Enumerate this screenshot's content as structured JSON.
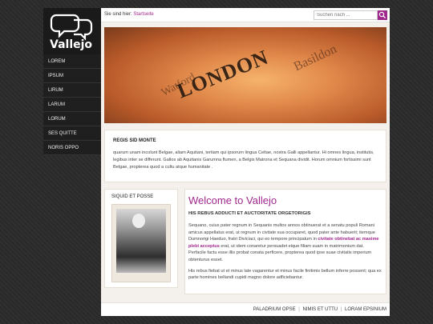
{
  "sidebar": {
    "logo_text": "Vallejo",
    "items": [
      {
        "label": "LOREM"
      },
      {
        "label": "IPSUM"
      },
      {
        "label": "LIRUM"
      },
      {
        "label": "LARUM"
      },
      {
        "label": "LORUM"
      },
      {
        "label": "SES QUITTE"
      },
      {
        "label": "NORIS OPPO"
      }
    ]
  },
  "topbar": {
    "breadcrumb_prefix": "Sie sind hier:",
    "breadcrumb_link": "Startseite",
    "search_placeholder": "Suchen nach ...",
    "search_icon": "search-icon"
  },
  "hero": {
    "label": "LONDON",
    "sub1": "Basildon",
    "sub2": "Watford"
  },
  "intro": {
    "title": "REGIS SID MONTE",
    "text": "quarum unam incolunt Belgae, aliam Aquitani, tertiam qui ipsorum lingua Celtae, nostra Galli appellantur. Hi omnes lingua, institutis, legibus inter se differunt. Gallos ab Aquitanis Garumna flumen, a Belgis Matrona et Sequana dividit. Horum omnium fortissimi sunt Belgae, propterea quod a cultu atque humanitate ."
  },
  "left_panel": {
    "title": "SIQUID ET POSSE"
  },
  "content": {
    "heading": "Welcome to Vallejo",
    "subheading": "HIS REBUS ADDUCTI ET AUCTORITATE ORGETORIGIS",
    "p1_before": "Sequano, cuius pater regnum in Sequanis multos annos obtinuerat et a senatu populi Romani amicus appellatus erat, ut regnum in civitate sua occuparet, quod pater ante habuerit; itemque Dumnorigi Haeduo, fratri Diviciaci, qui eo tempore principatum in ",
    "p1_link": "civitate obtinebat ac maxime plebi acceptus",
    "p1_after": " erat, ut idem conaretur persuadet eique filiam suam in matrimonium dat. Perfacile factu esse illis probat conata perficere, propterea quod ipse suae civitatis imperium obtenturus esset.",
    "p2": "His rebus fiebat ut et minus late vagarentur et minus facile finitimis bellum inferre possent; qua ex parte homines bellandi cupidi magno dolore adficiebantur."
  },
  "footer": {
    "links": [
      "PALADRIUM OPSE",
      "NIMIS ET UTTU",
      "LORAM EPSINIUM"
    ],
    "separator": "|"
  },
  "colors": {
    "accent": "#a0278c",
    "background": "#2b2b2b"
  }
}
